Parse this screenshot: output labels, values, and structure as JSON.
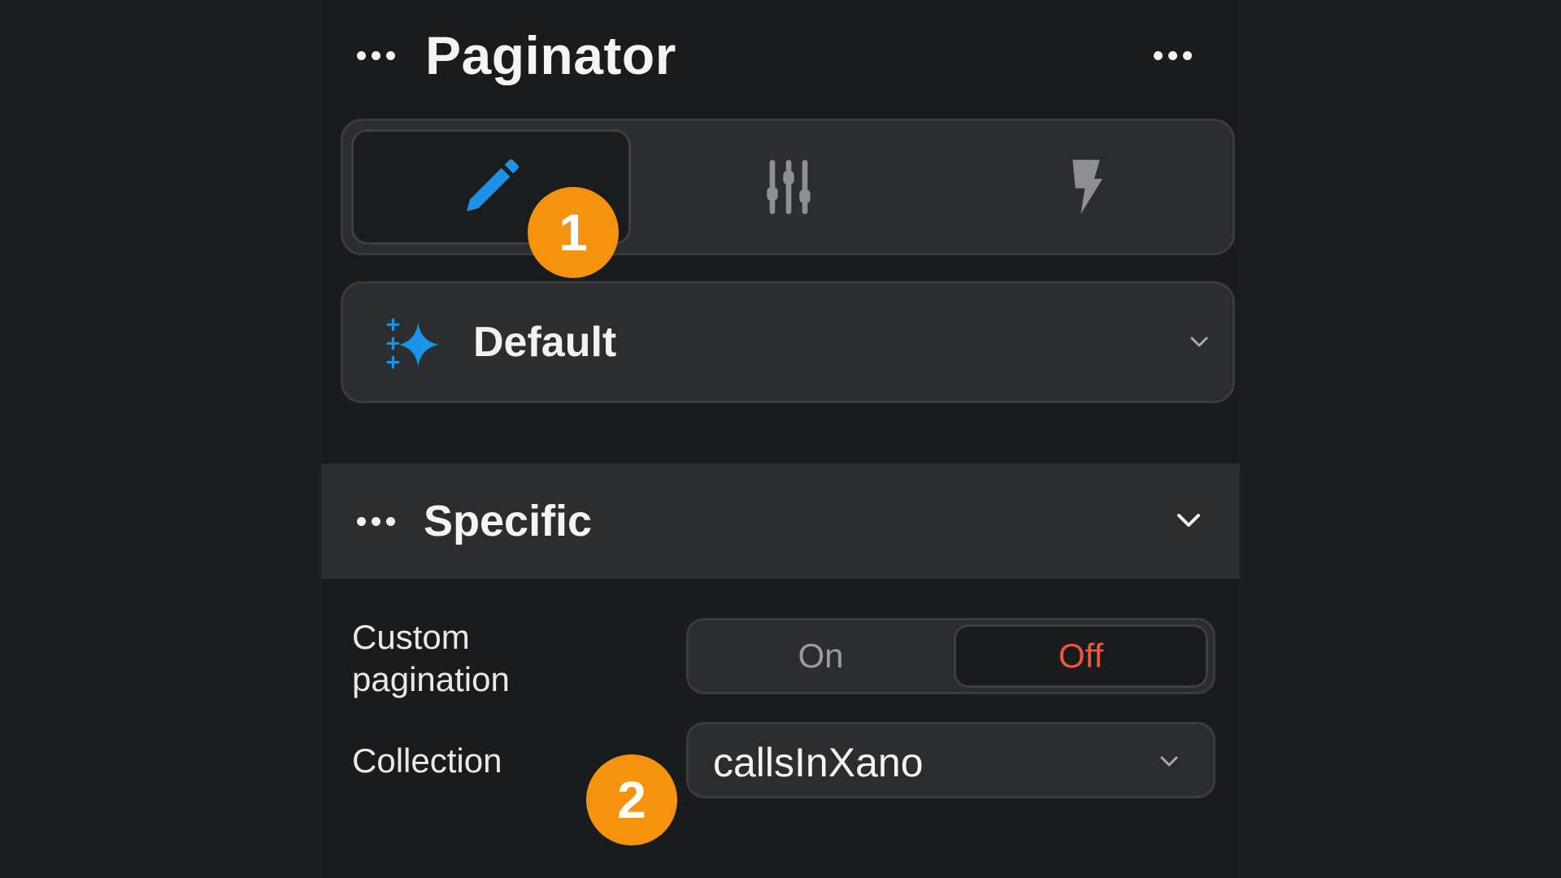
{
  "panel": {
    "title": "Paginator",
    "tabs": [
      {
        "icon": "pencil-icon",
        "active": true
      },
      {
        "icon": "sliders-icon",
        "active": false
      },
      {
        "icon": "lightning-icon",
        "active": false
      }
    ],
    "badges": [
      "1",
      "2"
    ],
    "theme_select": {
      "icon": "sparkles-icon",
      "value": "Default"
    },
    "section": {
      "title": "Specific",
      "fields": {
        "custom_pagination": {
          "label_line1": "Custom",
          "label_line2": "pagination",
          "options": [
            "On",
            "Off"
          ],
          "selected": "Off"
        },
        "collection": {
          "label": "Collection",
          "value": "callsInXano"
        }
      }
    }
  },
  "colors": {
    "background": "#1b1d1e",
    "panel": "#1a1b1c",
    "surface": "#2c2d2f",
    "accent_blue": "#1a93e8",
    "badge_orange": "#f5930f",
    "off_red": "#f0573a"
  }
}
